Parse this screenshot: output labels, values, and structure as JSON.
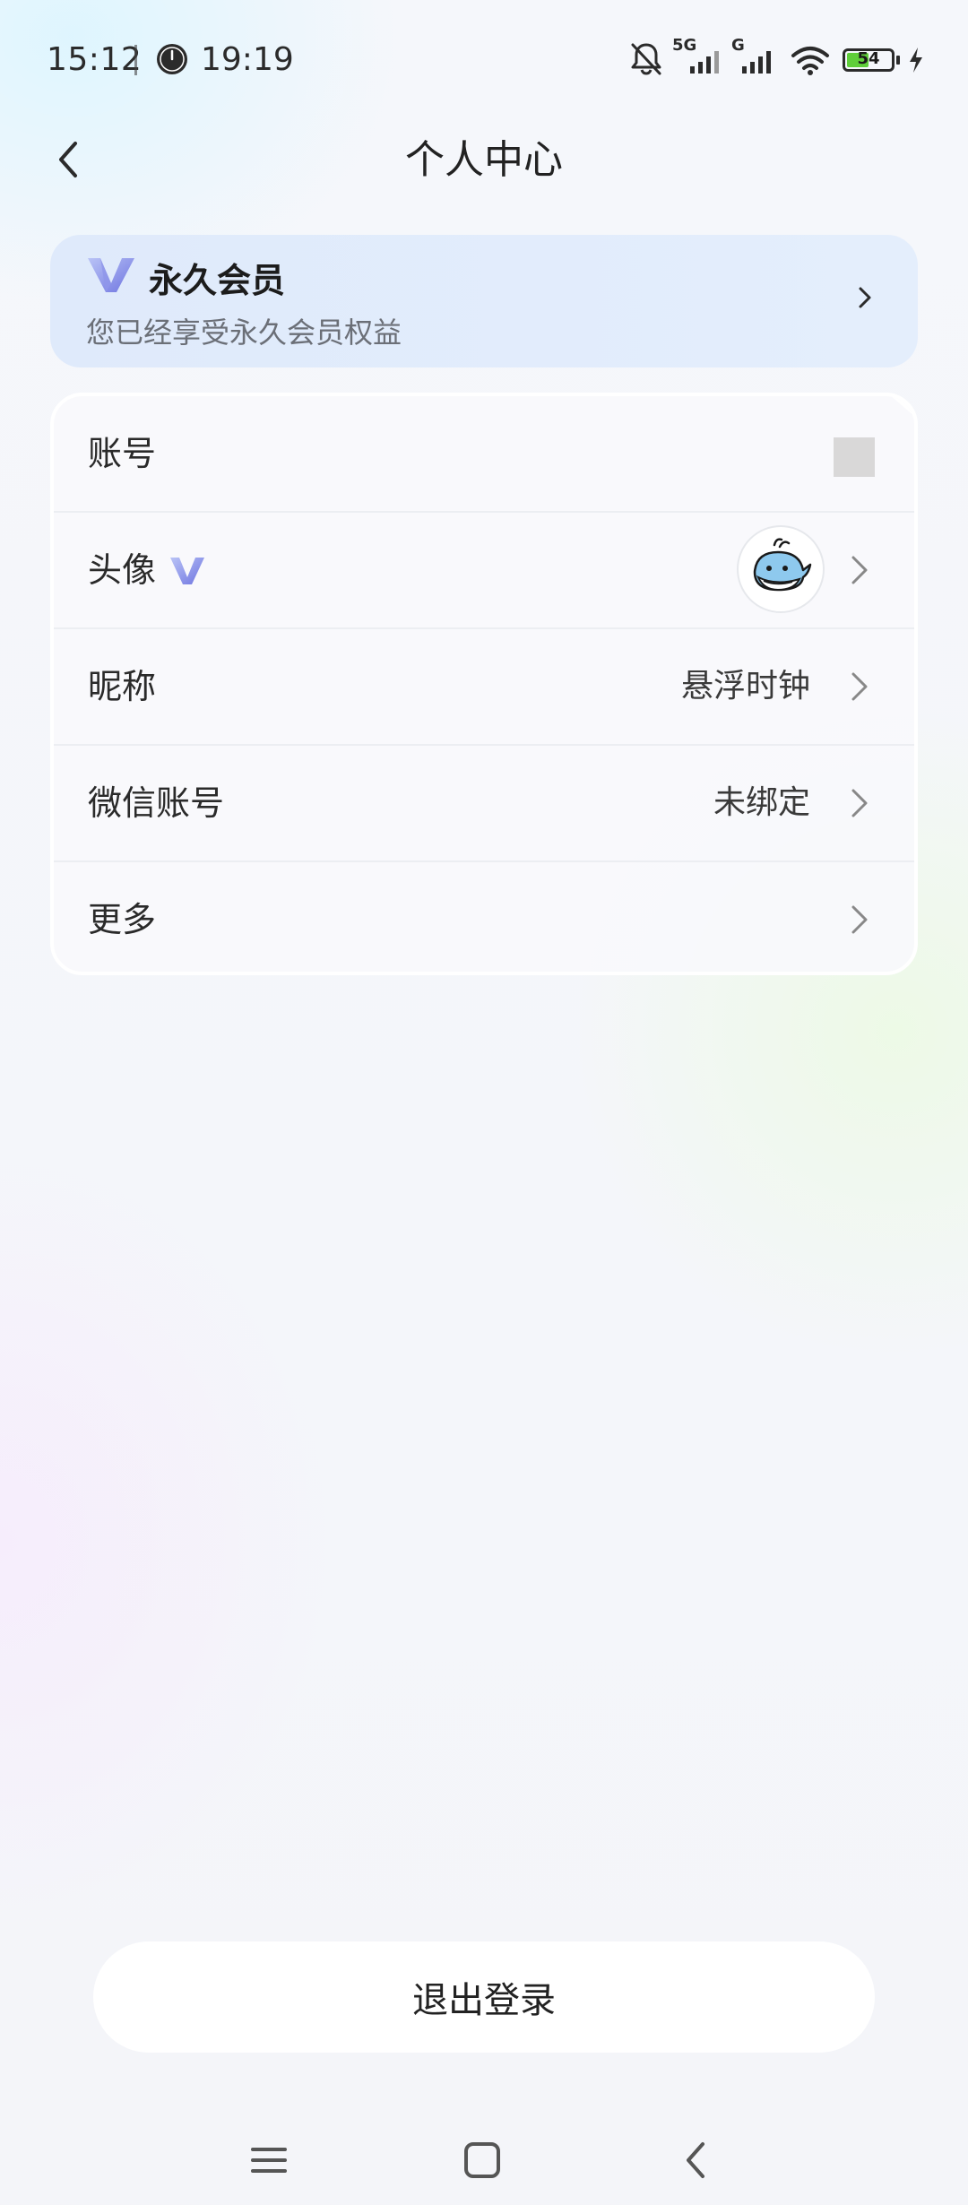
{
  "status_bar": {
    "time": "15:12",
    "clock_time": "19:19",
    "network_5g": "5G",
    "network_g": "G",
    "battery_percent": "54",
    "battery_level": 0.54,
    "battery_color": "#5fce3a",
    "icons": [
      "clock-icon",
      "bell-muted-icon",
      "signal-icon",
      "wifi-icon",
      "battery-icon",
      "charging-icon"
    ]
  },
  "header": {
    "title": "个人中心",
    "back_icon": "chevron-left-icon"
  },
  "member_card": {
    "title": "永久会员",
    "subtitle": "您已经享受永久会员权益",
    "logo_icon": "vip-logo-icon",
    "chevron_icon": "chevron-right-icon",
    "accent_color": "#7b82e6"
  },
  "settings": {
    "rows": [
      {
        "label": "账号",
        "value": ""
      },
      {
        "label": "头像",
        "value": ""
      },
      {
        "label": "昵称",
        "value": "悬浮时钟"
      },
      {
        "label": "微信账号",
        "value": "未绑定"
      },
      {
        "label": "更多",
        "value": ""
      }
    ]
  },
  "logout": {
    "label": "退出登录"
  },
  "nav_bar": {
    "icons": [
      "menu-icon",
      "home-icon",
      "back-icon"
    ]
  }
}
